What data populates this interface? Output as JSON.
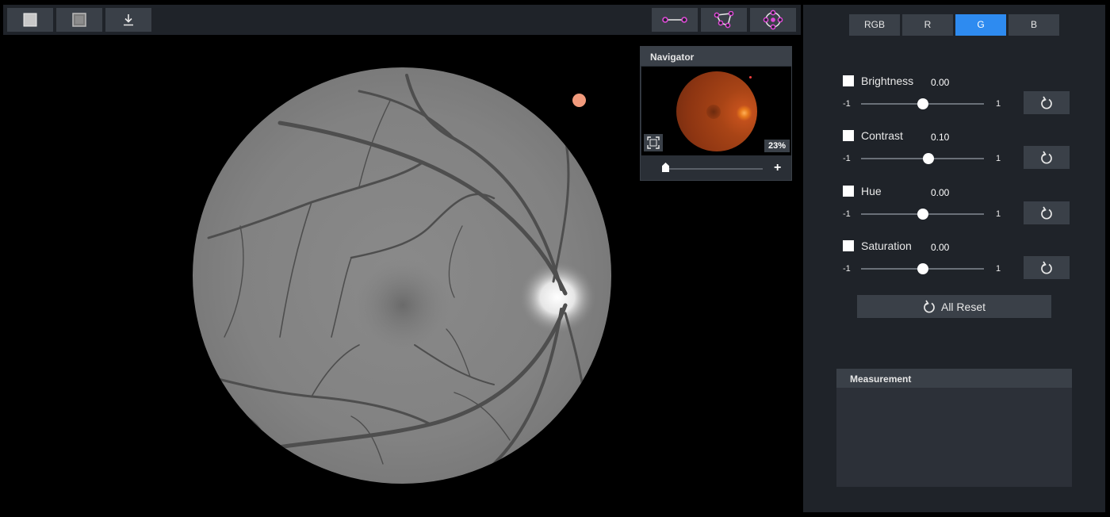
{
  "toolbar": {
    "left_tools": [
      {
        "icon": "square-solid-icon"
      },
      {
        "icon": "square-framed-icon"
      },
      {
        "icon": "download-icon"
      }
    ],
    "right_tools": [
      {
        "icon": "line-measure-icon"
      },
      {
        "icon": "polygon-measure-icon"
      },
      {
        "icon": "circle-measure-icon"
      }
    ],
    "accent": "#e04ad8"
  },
  "navigator": {
    "title": "Navigator",
    "zoom": "23%",
    "zoom_plus": "+",
    "slider_value": 0.0
  },
  "channels": {
    "items": [
      "RGB",
      "R",
      "G",
      "B"
    ],
    "active": "G",
    "active_color": "#2e8bf0"
  },
  "adjustments": [
    {
      "label": "Brightness",
      "value": "0.00",
      "min": "-1",
      "max": "1",
      "level": 0.0
    },
    {
      "label": "Contrast",
      "value": "0.10",
      "min": "-1",
      "max": "1",
      "level": 0.1
    },
    {
      "label": "Hue",
      "value": "0.00",
      "min": "-1",
      "max": "1",
      "level": 0.0
    },
    {
      "label": "Saturation",
      "value": "0.00",
      "min": "-1",
      "max": "1",
      "level": 0.0
    }
  ],
  "all_reset_label": "All Reset",
  "measurement": {
    "title": "Measurement"
  },
  "marker_color": "#f19a7c"
}
